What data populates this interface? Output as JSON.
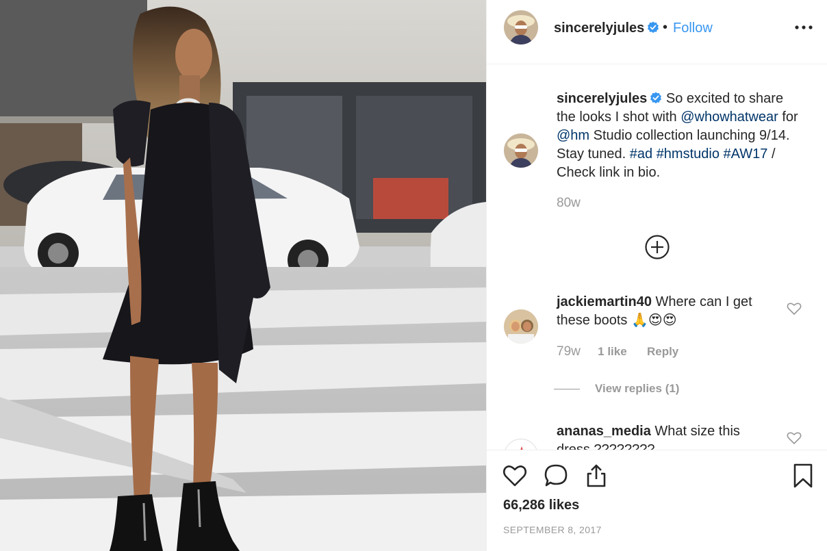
{
  "post": {
    "image_description_icon": "photo",
    "author": {
      "username": "sincerelyjules",
      "verified": true,
      "follow_separator": "•",
      "follow_label": "Follow",
      "more_icon": "more-options-icon"
    },
    "caption": {
      "username": "sincerelyjules",
      "text_1": "So excited to share the looks I shot with",
      "mention_1": "@whowhatwear",
      "text_2": "for",
      "mention_2": "@hm",
      "text_3": "Studio collection launching 9/14. Stay tuned.",
      "hashtag_1": "#ad",
      "hashtag_2": "#hmstudio",
      "hashtag_3": "#AW17",
      "text_4": "/ Check link in bio.",
      "time": "80w"
    },
    "comments": [
      {
        "username": "jackiemartin40",
        "text": "Where can I get these boots",
        "emoji": "🙏😍😍",
        "time": "79w",
        "likes": "1 like",
        "reply_label": "Reply",
        "view_replies": "View replies (1)"
      },
      {
        "username": "ananas_media",
        "text": "What size this dress ????????"
      }
    ],
    "likes": "66,286 likes",
    "date": "SEPTEMBER 8, 2017"
  },
  "colors": {
    "link_blue": "#3897f0",
    "mention_navy": "#003569",
    "muted_gray": "#999999",
    "text": "#262626"
  }
}
